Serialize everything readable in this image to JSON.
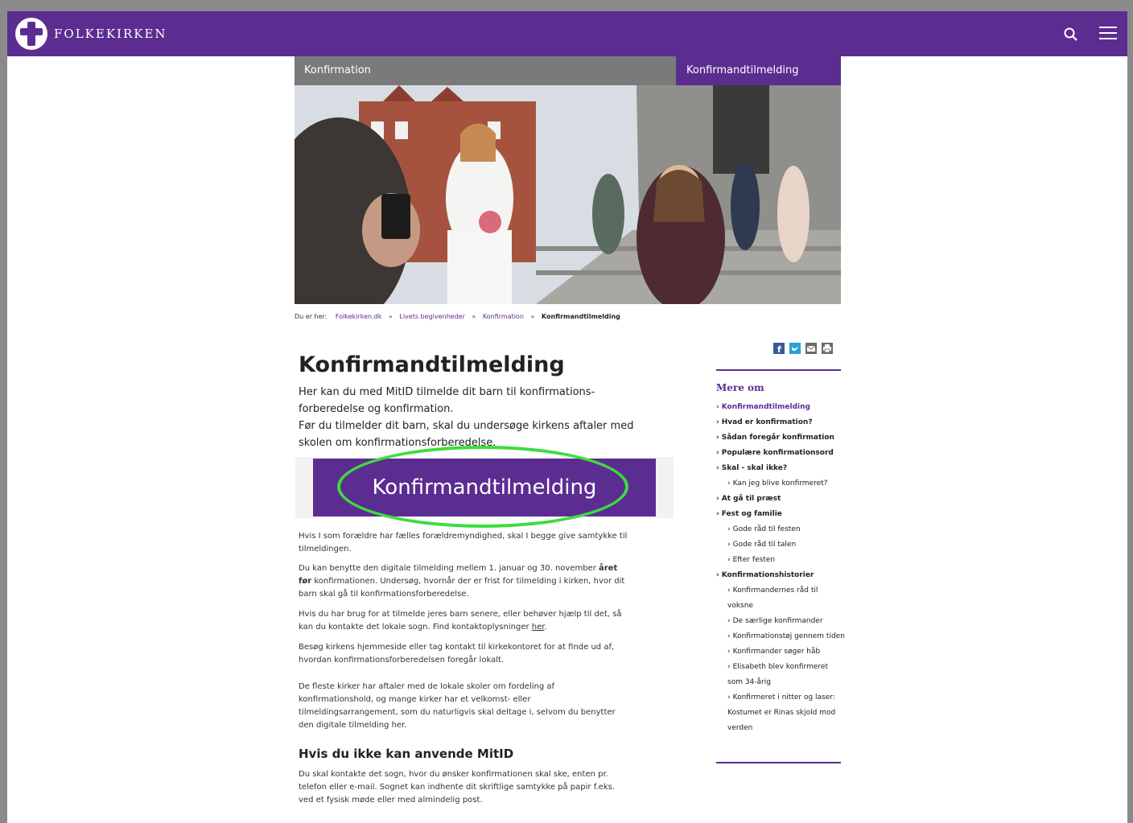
{
  "header": {
    "logo_text": "FOLKEKIRKEN",
    "brand_color": "#5c2d91",
    "icons": [
      "search-icon",
      "menu-icon"
    ]
  },
  "tabs": {
    "left": "Konfirmation",
    "right": "Konfirmandtilmelding"
  },
  "breadcrumb": {
    "prefix": "Du er her:",
    "items": [
      "Folkekirken.dk",
      "Livets begivenheder",
      "Konfirmation"
    ],
    "current": "Konfirmandtilmelding",
    "separator": "»"
  },
  "share_icons": [
    "facebook-icon",
    "twitter-icon",
    "mail-icon",
    "print-icon"
  ],
  "main": {
    "title": "Konfirmandtilmelding",
    "intro_line1": "Her kan du med MitID tilmelde dit barn til konfirmations-forberedelse og konfirmation.",
    "intro_line2": "Før du tilmelder dit barn, skal du undersøge kirkens aftaler med skolen om konfirmationsforberedelse.",
    "cta_label": "Konfirmandtilmelding",
    "p1": "Hvis I som forældre har fælles forældremyndighed, skal I begge give samtykke til tilmeldingen.",
    "p2_a": "Du kan benytte den digitale tilmelding mellem 1. januar og 30. november ",
    "p2_bold": "året før",
    "p2_b": " konfirmationen. Undersøg, hvornår der er frist for tilmelding i kirken, hvor dit barn skal gå til konfirmationsforberedelse.",
    "p3_a": "Hvis du har brug for at tilmelde jeres barn senere, eller behøver hjælp til det, så kan du kontakte det lokale sogn. Find kontaktoplysninger ",
    "p3_link": "her",
    "p3_b": ".",
    "p4": "Besøg kirkens hjemmeside eller tag kontakt til kirkekontoret for at finde ud af, hvordan konfirmationsforberedelsen foregår lokalt.",
    "p5": "De fleste kirker har aftaler med de lokale skoler om fordeling af konfirmationshold, og mange kirker har et velkomst- eller tilmeldingsarrangement, som du naturligvis skal deltage i, selvom du benytter den digitale tilmelding her.",
    "subheading": "Hvis du ikke kan anvende MitID",
    "p6": "Du skal kontakte det sogn, hvor du ønsker konfirmationen skal ske, enten pr. telefon eller e-mail. Sognet kan indhente dit skriftlige samtykke på papir f.eks. ved et fysisk møde eller med almindelig post."
  },
  "sidebar": {
    "title": "Mere om",
    "items": [
      {
        "label": "Konfirmandtilmelding",
        "level": 1,
        "active": true
      },
      {
        "label": "Hvad er konfirmation?",
        "level": 1
      },
      {
        "label": "Sådan foregår konfirmation",
        "level": 1
      },
      {
        "label": "Populære konfirmationsord",
        "level": 1
      },
      {
        "label": "Skal - skal ikke?",
        "level": 1
      },
      {
        "label": "Kan jeg blive konfirmeret?",
        "level": 2
      },
      {
        "label": "At gå til præst",
        "level": 1
      },
      {
        "label": "Fest og familie",
        "level": 1
      },
      {
        "label": "Gode råd til festen",
        "level": 2
      },
      {
        "label": "Gode råd til talen",
        "level": 2
      },
      {
        "label": "Efter festen",
        "level": 2
      },
      {
        "label": "Konfirmationshistorier",
        "level": 1
      },
      {
        "label": "Konfirmandernes råd til voksne",
        "level": 2
      },
      {
        "label": "De særlige konfirmander",
        "level": 2
      },
      {
        "label": "Konfirmationstøj gennem tiden",
        "level": 2
      },
      {
        "label": "Konfirmander søger håb",
        "level": 2
      },
      {
        "label": "Elisabeth blev konfirmeret som 34-årig",
        "level": 2
      },
      {
        "label": "Konfirmeret i nitter og laser: Kostumet er Rinas skjold mod verden",
        "level": 2
      }
    ]
  }
}
